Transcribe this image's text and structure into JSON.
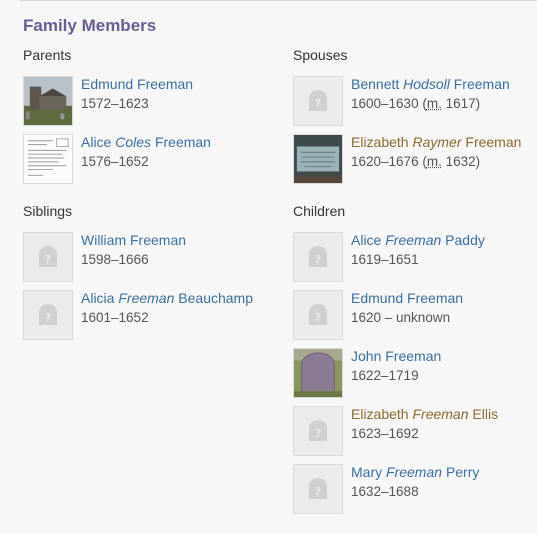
{
  "section_title": "Family Members",
  "groups": {
    "parents": {
      "title": "Parents",
      "people": [
        {
          "first": "Edmund",
          "middle": "",
          "last": "Freeman",
          "dates": "1572–1623",
          "marriage": "",
          "photo": "church-photo"
        },
        {
          "first": "Alice",
          "middle": "Coles",
          "last": "Freeman",
          "dates": "1576–1652",
          "marriage": "",
          "photo": "document-photo"
        }
      ]
    },
    "spouses": {
      "title": "Spouses",
      "people": [
        {
          "first": "Bennett",
          "middle": "Hodsoll",
          "last": "Freeman",
          "dates": "1600–1630",
          "marriage_prefix": " (",
          "marriage_m": "m.",
          "marriage_year": " 1617)",
          "photo": "placeholder-icon"
        },
        {
          "first": "Elizabeth",
          "middle": "Raymer",
          "last": "Freeman",
          "dates": "1620–1676",
          "marriage_prefix": " (",
          "marriage_m": "m.",
          "marriage_year": " 1632)",
          "photo": "plaque-photo"
        }
      ]
    },
    "siblings": {
      "title": "Siblings",
      "people": [
        {
          "first": "William",
          "middle": "",
          "last": "Freeman",
          "dates": "1598–1666",
          "photo": "placeholder-icon"
        },
        {
          "first": "Alicia",
          "middle": "Freeman",
          "last": "Beauchamp",
          "dates": "1601–1652",
          "photo": "placeholder-icon"
        }
      ]
    },
    "children": {
      "title": "Children",
      "people": [
        {
          "first": "Alice",
          "middle": "Freeman",
          "last": "Paddy",
          "dates": "1619–1651",
          "photo": "placeholder-icon"
        },
        {
          "first": "Edmund",
          "middle": "",
          "last": "Freeman",
          "dates": "1620 – unknown",
          "photo": "placeholder-icon"
        },
        {
          "first": "John",
          "middle": "",
          "last": "Freeman",
          "dates": "1622–1719",
          "photo": "headstone-photo"
        },
        {
          "first": "Elizabeth",
          "middle": "Freeman",
          "last": "Ellis",
          "dates": "1623–1692",
          "photo": "placeholder-icon"
        },
        {
          "first": "Mary",
          "middle": "Freeman",
          "last": "Perry",
          "dates": "1632–1688",
          "photo": "placeholder-icon"
        }
      ]
    }
  },
  "colors": {
    "title": "#6b5b95",
    "link": "#3b6fa0",
    "memorial_link": "#8a6a2e"
  }
}
